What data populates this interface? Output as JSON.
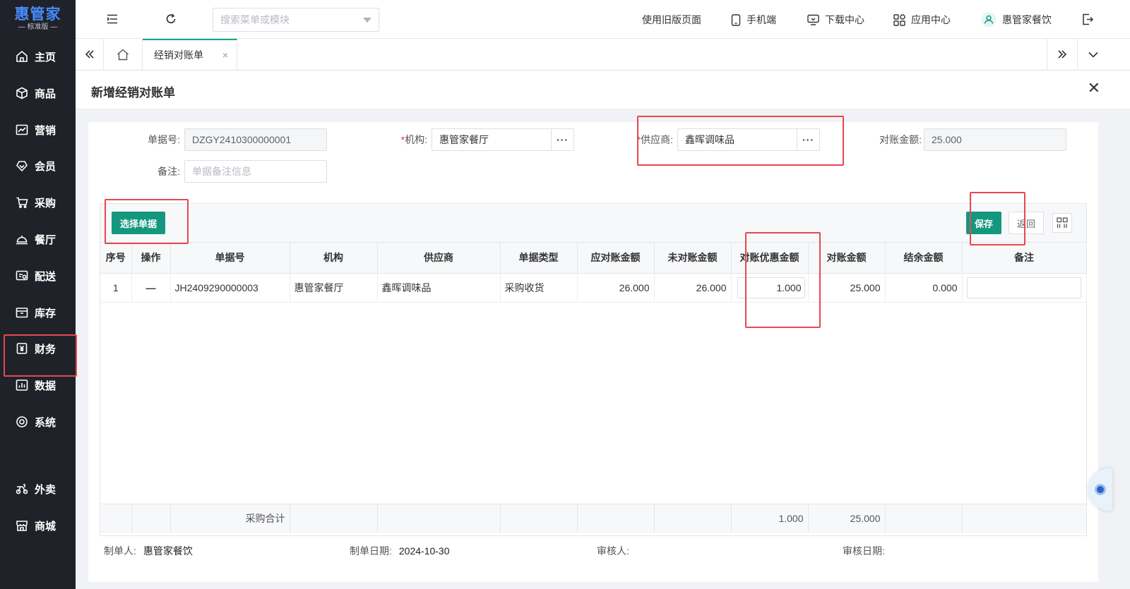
{
  "app": {
    "brand": "惠管家",
    "edition": "— 标准版 —"
  },
  "sidebar": {
    "items": [
      {
        "label": "主页",
        "icon": "home-icon"
      },
      {
        "label": "商品",
        "icon": "cube-icon"
      },
      {
        "label": "营销",
        "icon": "chart-icon"
      },
      {
        "label": "会员",
        "icon": "diamond-icon"
      },
      {
        "label": "采购",
        "icon": "cart-icon"
      },
      {
        "label": "餐厅",
        "icon": "cloche-icon"
      },
      {
        "label": "配送",
        "icon": "truck-icon"
      },
      {
        "label": "库存",
        "icon": "box-icon"
      },
      {
        "label": "财务",
        "icon": "yuan-icon"
      },
      {
        "label": "数据",
        "icon": "bar-chart-icon"
      },
      {
        "label": "系统",
        "icon": "settings-icon"
      },
      {
        "label": "外卖",
        "icon": "scooter-icon"
      },
      {
        "label": "商城",
        "icon": "store-icon"
      }
    ]
  },
  "header": {
    "search_placeholder": "搜索菜单或模块",
    "old_page": "使用旧版页面",
    "mobile": "手机端",
    "download": "下载中心",
    "apps": "应用中心",
    "user": "惠管家餐饮"
  },
  "tabs": {
    "active": "经销对账单",
    "close": "×"
  },
  "page": {
    "title": "新增经销对账单",
    "close": "✕"
  },
  "form": {
    "doc_no_label": "单据号:",
    "doc_no": "DZGY2410300000001",
    "org_label": "机构:",
    "org": "惠管家餐厅",
    "supplier_label": "供应商:",
    "supplier": "鑫晖调味品",
    "amount_label": "对账金额:",
    "amount": "25.000",
    "remark_label": "备注:",
    "remark_placeholder": "单据备注信息",
    "required_mark": "*",
    "more": "···"
  },
  "toolbar": {
    "select_docs": "选择单据",
    "save": "保存",
    "back": "返回"
  },
  "table": {
    "columns": [
      "序号",
      "操作",
      "单据号",
      "机构",
      "供应商",
      "单据类型",
      "应对账金额",
      "未对账金额",
      "对账优惠金额",
      "对账金额",
      "结余金额",
      "备注"
    ],
    "rows": [
      {
        "index": "1",
        "op": "—",
        "doc_no": "JH2409290000003",
        "org": "惠管家餐厅",
        "supplier": "鑫晖调味品",
        "type": "采购收货",
        "due": "26.000",
        "unpaid": "26.000",
        "discount": "1.000",
        "amount": "25.000",
        "balance": "0.000",
        "remark": ""
      }
    ],
    "footer": {
      "label": "采购合计",
      "discount": "1.000",
      "amount": "25.000"
    }
  },
  "meta": {
    "creator_label": "制单人:",
    "creator": "惠管家餐饮",
    "date_label": "制单日期:",
    "date": "2024-10-30",
    "auditor_label": "审核人:",
    "audit_date_label": "审核日期:"
  },
  "colors": {
    "accent": "#14977f",
    "sidebar_bg": "#1f2228",
    "highlight": "#e8474f",
    "danger": "#e4393c"
  }
}
